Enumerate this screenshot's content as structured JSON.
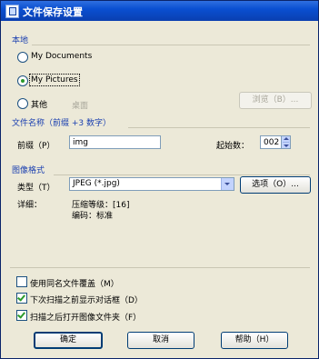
{
  "window": {
    "title": "文件保存设置"
  },
  "location": {
    "group_title": "本地",
    "options": [
      {
        "label": "My Documents",
        "selected": false
      },
      {
        "label": "My Pictures",
        "selected": true
      },
      {
        "label": "其他",
        "selected": false
      }
    ],
    "other_path": "桌面",
    "browse_label": "浏览（B）..."
  },
  "filename": {
    "group_title": "文件名称（前缀 +3 数字）",
    "prefix_label": "前缀（P）",
    "prefix_value": "img",
    "start_label": "起始数：",
    "start_value": "002"
  },
  "format": {
    "group_title": "图像格式",
    "type_label": "类型（T）",
    "type_value": "JPEG (*.jpg)",
    "options_label": "选项（O）...",
    "details_label": "详细：",
    "details_line1": "压缩等级：[16]",
    "details_line2": "编码：标准"
  },
  "checkboxes": [
    {
      "label": "使用同名文件覆盖（M）",
      "checked": false
    },
    {
      "label": "下次扫描之前显示对话框（D）",
      "checked": true
    },
    {
      "label": "扫描之后打开图像文件夹（F）",
      "checked": true
    }
  ],
  "buttons": {
    "ok": "确定",
    "cancel": "取消",
    "help": "帮助（H）"
  },
  "colors": {
    "titlebar": "#0a4fd1",
    "dialog_bg": "#ece9d8",
    "group_title": "#1a3fb0"
  }
}
